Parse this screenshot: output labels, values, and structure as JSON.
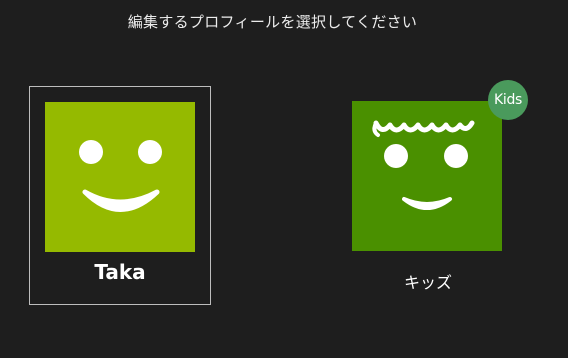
{
  "header": {
    "title": "編集するプロフィールを選択してください"
  },
  "profiles": [
    {
      "name": "Taka",
      "avatar_color": "#95ba00",
      "selected": true
    },
    {
      "name": "キッズ",
      "avatar_color": "#4a9000",
      "badge": "Kids",
      "badge_color": "#4a9a5c",
      "selected": false
    }
  ],
  "colors": {
    "background": "#1e1e1e",
    "selection_border": "#bdbdbd"
  }
}
